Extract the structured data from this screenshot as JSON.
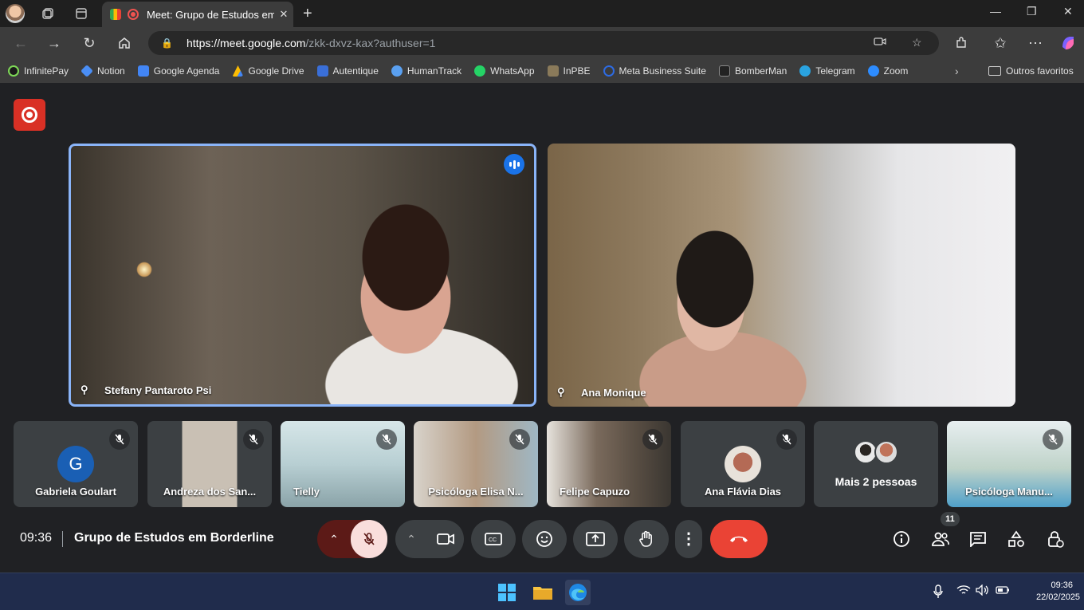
{
  "browser": {
    "tab_title": "Meet: Grupo de Estudos em",
    "url_host": "https://meet.google.com",
    "url_rest": "/zkk-dxvz-kax?authuser=1"
  },
  "bookmarks": [
    {
      "label": "InfinitePay",
      "color": "#1b1b1b"
    },
    {
      "label": "Notion",
      "color": "#4a8ef5"
    },
    {
      "label": "Google Agenda",
      "color": "#4285f4"
    },
    {
      "label": "Google Drive",
      "color": "#fbbc04"
    },
    {
      "label": "Autentique",
      "color": "#3a6fd8"
    },
    {
      "label": "HumanTrack",
      "color": "#5aa0f0"
    },
    {
      "label": "WhatsApp",
      "color": "#25d366"
    },
    {
      "label": "InPBE",
      "color": "#8a7a5a"
    },
    {
      "label": "Meta Business Suite",
      "color": "#2d6be3"
    },
    {
      "label": "BomberMan",
      "color": "#222222"
    },
    {
      "label": "Telegram",
      "color": "#2aa3e0"
    },
    {
      "label": "Zoom",
      "color": "#2d8cff"
    }
  ],
  "bookmarks_folder": "Outros favoritos",
  "main_participants": [
    {
      "name": "Stefany Pantaroto Psi"
    },
    {
      "name": "Ana Monique"
    }
  ],
  "small_participants": [
    {
      "name": "Gabriela Goulart",
      "initial": "G"
    },
    {
      "name": "Andreza dos San..."
    },
    {
      "name": "Tielly"
    },
    {
      "name": "Psicóloga Elisa N..."
    },
    {
      "name": "Felipe Capuzo"
    },
    {
      "name": "Ana Flávia Dias"
    },
    {
      "name": "Mais 2 pessoas"
    },
    {
      "name": "Psicóloga Manu..."
    }
  ],
  "meeting": {
    "time": "09:36",
    "name": "Grupo de Estudos em Borderline",
    "participant_count": "11"
  },
  "taskbar": {
    "time": "09:36",
    "date": "22/02/2025"
  }
}
